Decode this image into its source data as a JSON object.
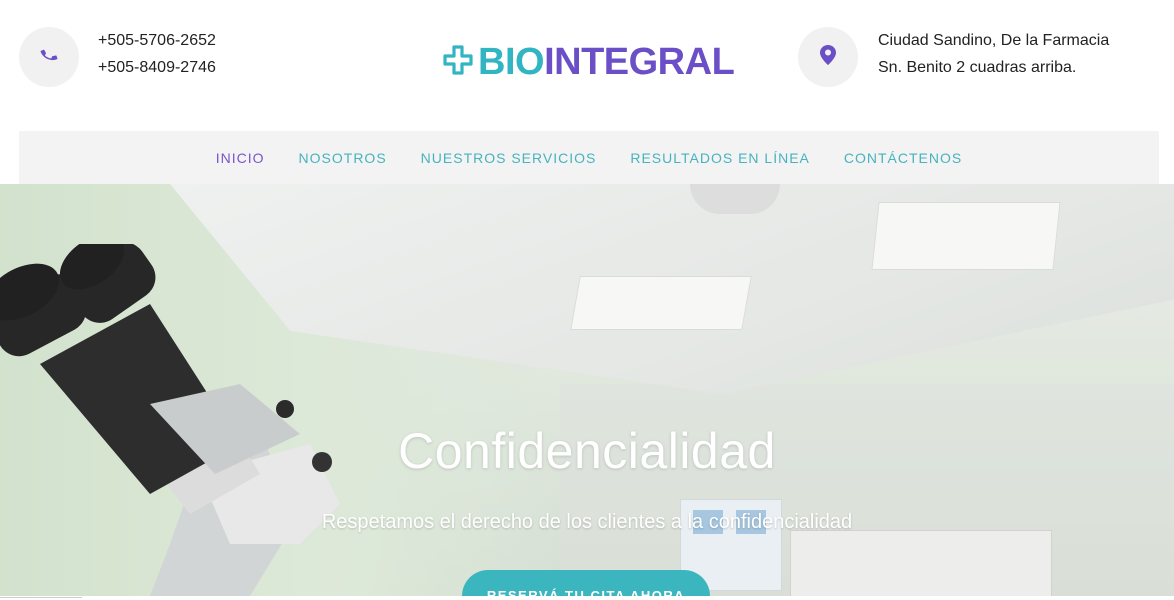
{
  "header": {
    "phones": [
      "+505-5706-2652",
      "+505-8409-2746"
    ],
    "address_lines": [
      "Ciudad Sandino, De la Farmacia",
      "Sn. Benito 2 cuadras arriba."
    ],
    "logo": {
      "part1": "BIO",
      "part2": "INTEGRAL"
    },
    "icons": {
      "phone": "phone-icon",
      "location": "map-pin-icon",
      "logo": "medical-cross-icon"
    }
  },
  "nav": {
    "items": [
      {
        "label": "INICIO",
        "active": true
      },
      {
        "label": "NOSOTROS",
        "active": false
      },
      {
        "label": "NUESTROS SERVICIOS",
        "active": false
      },
      {
        "label": "RESULTADOS EN LÍNEA",
        "active": false
      },
      {
        "label": "CONTÁCTENOS",
        "active": false
      }
    ]
  },
  "hero": {
    "title": "Confidencialidad",
    "subtitle": "Respetamos el derecho de los clientes a la confidencialidad",
    "cta_label": "RESERVÁ TU CITA AHORA"
  },
  "colors": {
    "teal": "#32b5c2",
    "purple": "#6a4fc6",
    "nav_active": "#7a55c8",
    "nav_text": "#47b3bd",
    "cta": "#3bb6bf"
  }
}
